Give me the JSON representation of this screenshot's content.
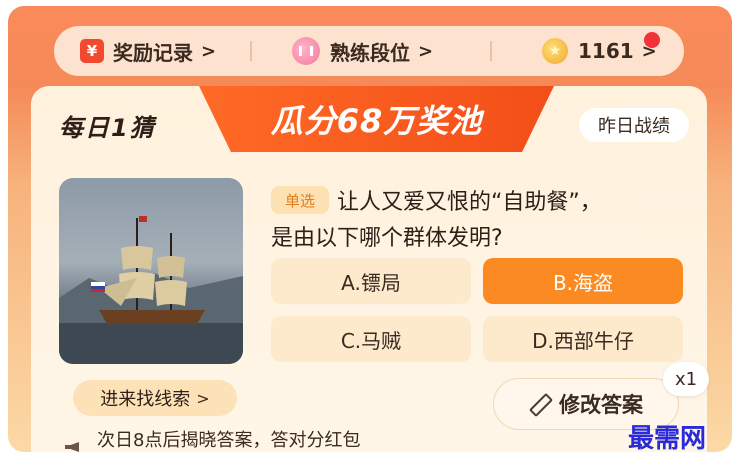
{
  "stats_bar": {
    "rewards_label": "奖励记录",
    "rewards_icon": "yen-icon",
    "skill_label": "熟练段位",
    "skill_icon": "rank-icon",
    "coins_value": "1161",
    "coins_icon": "coin-icon",
    "chevron": ">"
  },
  "header": {
    "brand": "每日1猜",
    "banner_title": "瓜分68万奖池",
    "yesterday_button": "昨日战绩"
  },
  "question": {
    "type_badge": "单选",
    "text_line1": "让人又爱又恨的“自助餐”，",
    "text_line2": "是由以下哪个群体发明?",
    "image_icon": "sailing-ship-image",
    "options": [
      {
        "label": "A.镖局",
        "selected": false
      },
      {
        "label": "B.海盗",
        "selected": true
      },
      {
        "label": "C.马贼",
        "selected": false
      },
      {
        "label": "D.西部牛仔",
        "selected": false
      }
    ]
  },
  "footer": {
    "clue_button": "进来找线索",
    "reveal_text": "次日8点后揭晓答案，答对分红包",
    "modify_button": "修改答案",
    "multiplier": "x1"
  },
  "watermark": "最需网",
  "colors": {
    "accent_orange": "#fb8a22",
    "banner_red": "#f34e18",
    "panel_bg": "#fff1dc"
  }
}
